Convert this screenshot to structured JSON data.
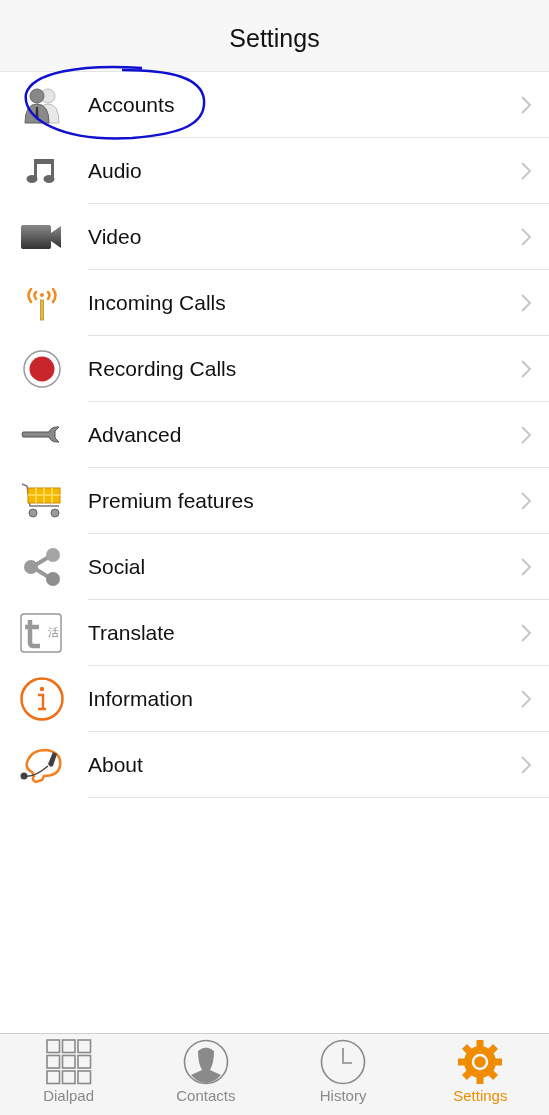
{
  "header": {
    "title": "Settings"
  },
  "items": [
    {
      "label": "Accounts",
      "kind": "people",
      "circled": true
    },
    {
      "label": "Audio",
      "kind": "music",
      "circled": false
    },
    {
      "label": "Video",
      "kind": "camera",
      "circled": false
    },
    {
      "label": "Incoming Calls",
      "kind": "antenna",
      "circled": false
    },
    {
      "label": "Recording Calls",
      "kind": "record",
      "circled": false
    },
    {
      "label": "Advanced",
      "kind": "wrench",
      "circled": false
    },
    {
      "label": "Premium features",
      "kind": "cart",
      "circled": false
    },
    {
      "label": "Social",
      "kind": "share",
      "circled": false
    },
    {
      "label": "Translate",
      "kind": "translate",
      "icon_text": "活",
      "circled": false
    },
    {
      "label": "Information",
      "kind": "info",
      "circled": false
    },
    {
      "label": "About",
      "kind": "headset",
      "circled": false
    }
  ],
  "tabs": [
    {
      "label": "Dialpad",
      "kind": "grid",
      "selected": false
    },
    {
      "label": "Contacts",
      "kind": "person",
      "selected": false
    },
    {
      "label": "History",
      "kind": "clock",
      "selected": false
    },
    {
      "label": "Settings",
      "kind": "gear",
      "selected": true
    }
  ]
}
